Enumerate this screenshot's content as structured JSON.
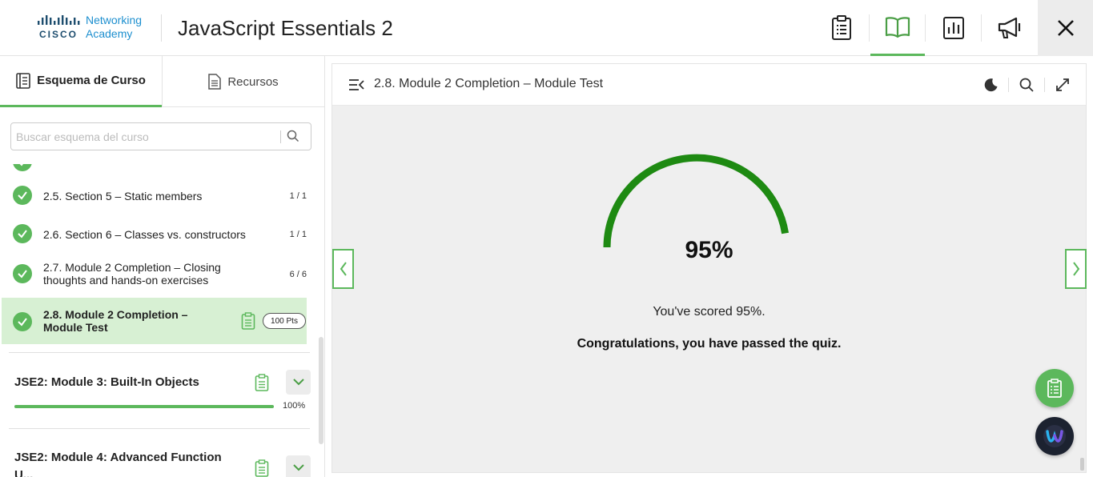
{
  "header": {
    "logo": {
      "brand": "CISCO",
      "line1": "Networking",
      "line2": "Academy"
    },
    "title": "JavaScript Essentials 2",
    "icons": [
      "clipboard-icon",
      "book-icon",
      "bar-chart-icon",
      "megaphone-icon",
      "close-icon"
    ]
  },
  "sidebar": {
    "tabs": [
      {
        "label": "Esquema de Curso",
        "icon": "outline-icon",
        "active": true
      },
      {
        "label": "Recursos",
        "icon": "document-icon",
        "active": false
      }
    ],
    "search": {
      "placeholder": "Buscar esquema del curso",
      "value": ""
    },
    "items": [
      {
        "label": "2.5. Section 5 – Static members",
        "count": "1 / 1",
        "status": "complete"
      },
      {
        "label": "2.6. Section 6 – Classes vs. constructors",
        "count": "1 / 1",
        "status": "complete"
      },
      {
        "label_line1": "2.7. Module 2 Completion – Closing",
        "label_line2": "thoughts and hands-on exercises",
        "count": "6 / 6",
        "status": "complete"
      },
      {
        "label_line1": "2.8. Module 2 Completion –",
        "label_line2": "Module Test",
        "points": "100 Pts",
        "status": "complete",
        "current": true
      }
    ],
    "modules": [
      {
        "title": "JSE2: Module 3: Built-In Objects",
        "progress_label": "100%",
        "progress": 1.0
      },
      {
        "title": "JSE2: Module 4: Advanced Function",
        "title_cont": "U..."
      }
    ]
  },
  "main": {
    "title": "2.8. Module 2 Completion – Module Test",
    "score": "95%",
    "score_value": 0.95,
    "scored_text": "You've scored 95%.",
    "congrats_text": "Congratulations, you have passed the quiz.",
    "accent": "#1e8a12"
  },
  "colors": {
    "brand_green": "#5cb85c",
    "gauge_green": "#1e8a12",
    "current_bg": "#d7f0d3"
  }
}
